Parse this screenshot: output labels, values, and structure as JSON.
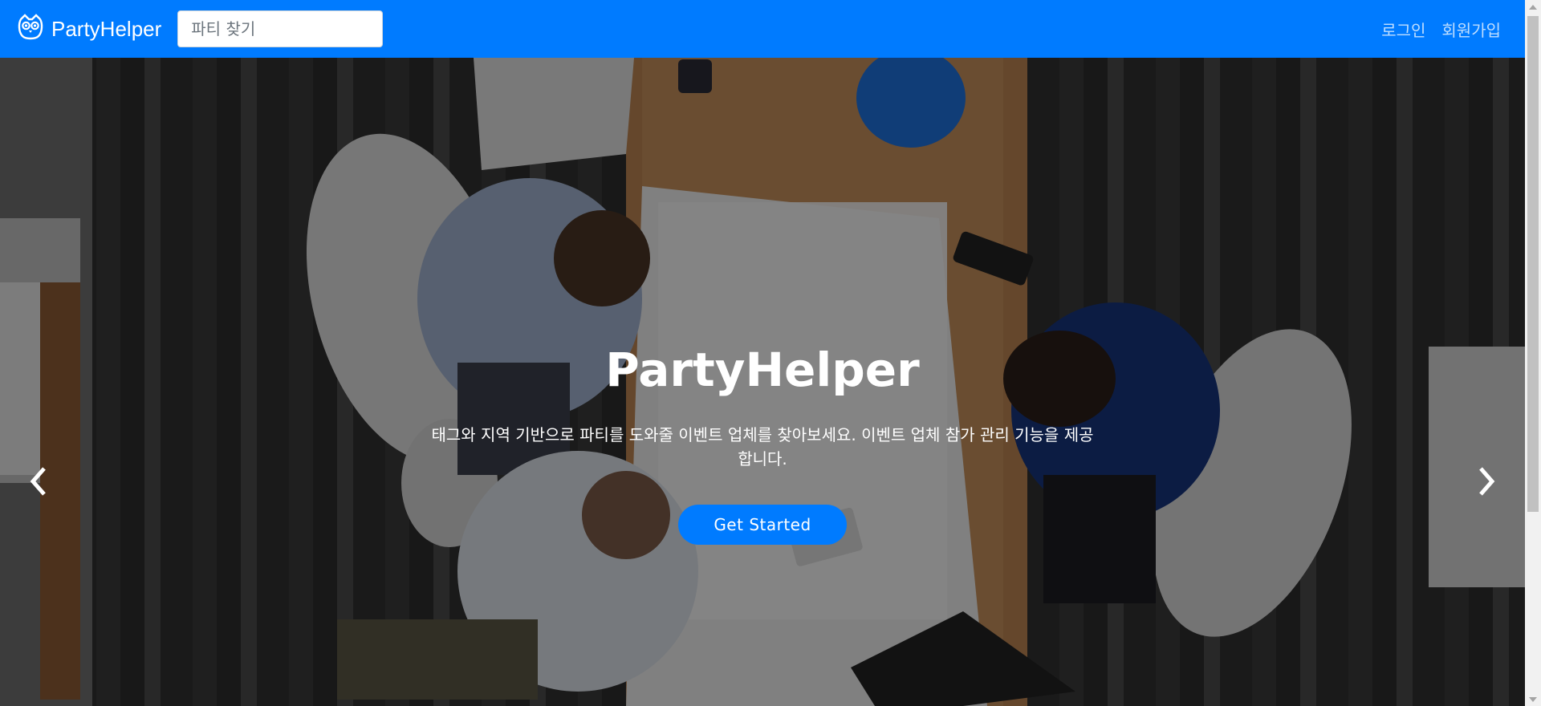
{
  "navbar": {
    "brand": "PartyHelper",
    "search_placeholder": "파티 찾기",
    "links": {
      "login": "로그인",
      "signup": "회원가입"
    },
    "color": "#007bff"
  },
  "hero": {
    "title": "PartyHelper",
    "description": "태그와 지역 기반으로 파티를 도와줄 이벤트 업체를 찾아보세요. 이벤트 업체 참가 관리 기능을 제공합니다.",
    "cta_label": "Get Started"
  },
  "icons": {
    "brand": "owl-logo-icon",
    "prev": "chevron-left-icon",
    "next": "chevron-right-icon"
  }
}
